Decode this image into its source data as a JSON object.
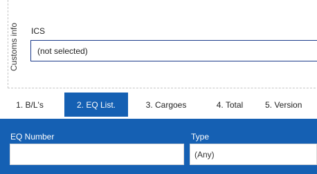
{
  "customs": {
    "section_label": "Customs info",
    "ics_label": "ICS",
    "ics_value": "(not selected)"
  },
  "tabs": [
    {
      "label": "1. B/L's",
      "active": false
    },
    {
      "label": "2. EQ List.",
      "active": true
    },
    {
      "label": "3. Cargoes",
      "active": false
    },
    {
      "label": "4. Total",
      "active": false
    },
    {
      "label": "5. Version",
      "active": false
    }
  ],
  "filters": {
    "eq_number_label": "EQ Number",
    "eq_number_value": "",
    "type_label": "Type",
    "type_value": "(Any)"
  },
  "colors": {
    "accent": "#1560b3",
    "select_border": "#1b3a8a"
  }
}
